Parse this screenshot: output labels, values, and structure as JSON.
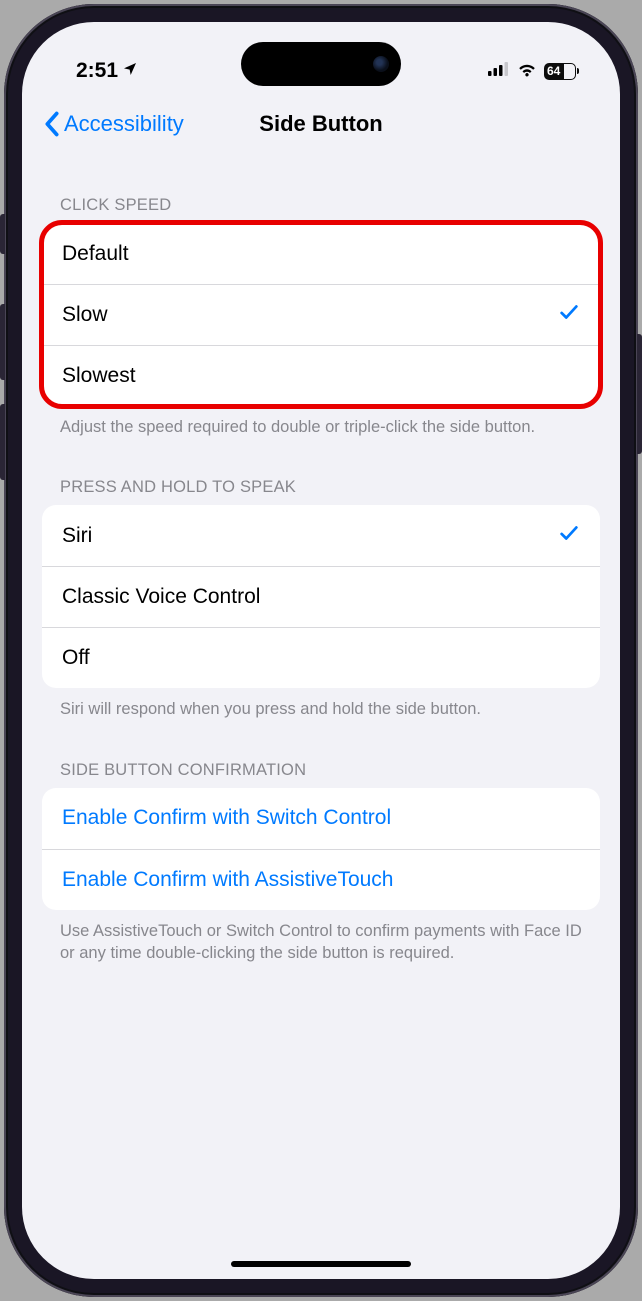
{
  "statusBar": {
    "time": "2:51",
    "batteryPercent": "64"
  },
  "nav": {
    "back": "Accessibility",
    "title": "Side Button"
  },
  "sections": {
    "clickSpeed": {
      "header": "CLICK SPEED",
      "options": {
        "default": "Default",
        "slow": "Slow",
        "slowest": "Slowest"
      },
      "footer": "Adjust the speed required to double or triple-click the side button."
    },
    "pressHold": {
      "header": "PRESS AND HOLD TO SPEAK",
      "options": {
        "siri": "Siri",
        "classic": "Classic Voice Control",
        "off": "Off"
      },
      "footer": "Siri will respond when you press and hold the side button."
    },
    "confirmation": {
      "header": "SIDE BUTTON CONFIRMATION",
      "options": {
        "switchControl": "Enable Confirm with Switch Control",
        "assistiveTouch": "Enable Confirm with AssistiveTouch"
      },
      "footer": "Use AssistiveTouch or Switch Control to confirm payments with Face ID or any time double-clicking the side button is required."
    }
  }
}
